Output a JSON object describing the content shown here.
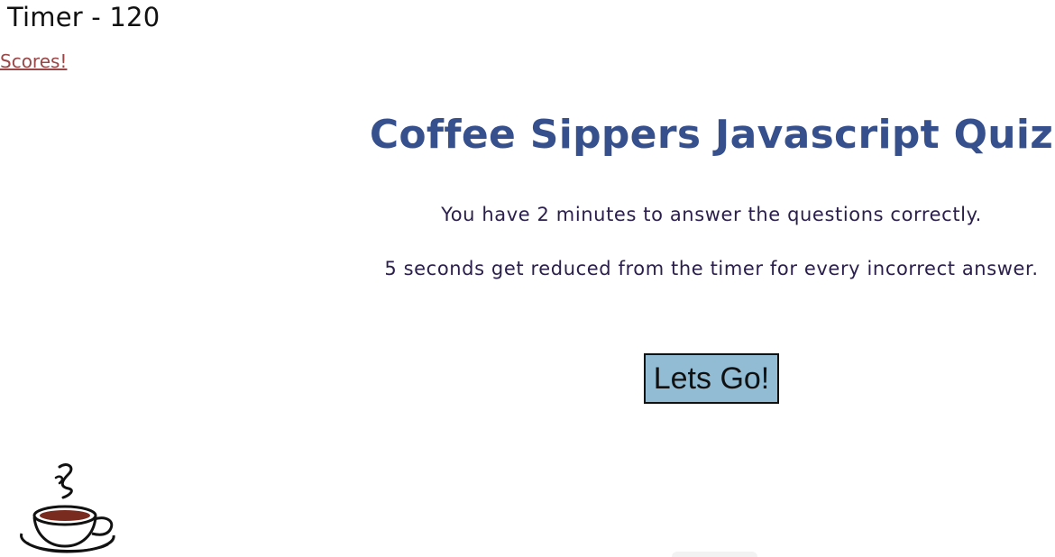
{
  "header": {
    "timer_text": "Timer - 120",
    "scores_link": "Scores!"
  },
  "main": {
    "title": "Coffee Sippers Javascript Quiz",
    "instruction_1": "You have 2 minutes to answer the questions correctly.",
    "instruction_2": "5 seconds get reduced from the timer for every incorrect answer.",
    "start_button": "Lets Go!"
  },
  "icons": {
    "logo": "coffee-cup-icon"
  },
  "colors": {
    "title": "#36508e",
    "link": "#9a4747",
    "button_bg": "#92bcd3",
    "text": "#2a1f4a"
  }
}
